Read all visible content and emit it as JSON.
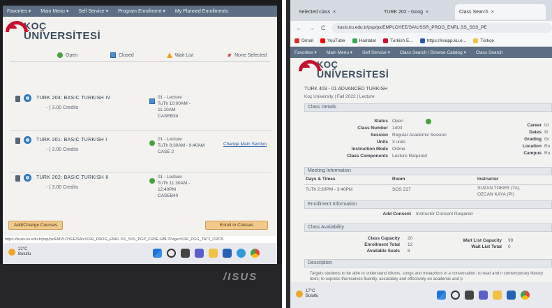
{
  "left": {
    "nav": [
      "Favorites ▾",
      "Main Menu ▾",
      "Self Service ▾",
      "Program Enrollment ▾",
      "My Planned Enrollments"
    ],
    "logo": {
      "line1": "KOÇ",
      "line2": "ÜNİVERSİTESİ"
    },
    "legend": {
      "open": "Open",
      "closed": "Closed",
      "wait": "Wait List",
      "none": "None Selected"
    },
    "courses": [
      {
        "name": "TURK 204: BASIC TURKISH IV",
        "credits": "- ( 3.00 Credits",
        "section": "01 - Lecture",
        "time": "TuTh 10:00AM -",
        "time2": "11:10AM",
        "room": "CASEB34",
        "status": "closed",
        "change": ""
      },
      {
        "name": "TURK 201: BASIC TURKISH I",
        "credits": "- ( 3.00 Credits",
        "section": "01 - Lecture",
        "time": "TuTh 8:30AM - 9:40AM",
        "time2": "",
        "room": "CASE 2",
        "status": "open",
        "change": "Change Main Section"
      },
      {
        "name": "TURK 202: BASIC TURKISH II",
        "credits": "- ( 3.00 Credits",
        "section": "01 - Lecture",
        "time": "TuTh 11:30AM -",
        "time2": "12:40PM",
        "room": "CASEB40",
        "status": "open",
        "change": ""
      }
    ],
    "add_change_button": "Add/Change Courses",
    "enroll_button": "Enroll in Classes",
    "status_url": "https://kusis.ku.edu.tr/psp/ps/EMPLOYEE/SA/c/SSR_PROG_ENRL.SS_SSS_PGP_CRSE.GBL?Page=SSR_PGG_TAT2_CROS",
    "weather": {
      "temp": "22°C",
      "desc": "Bulutlu"
    },
    "brand": "/ISUS"
  },
  "right": {
    "tabs": [
      "Selected class",
      "TURK 202 - Goog",
      "Class Search"
    ],
    "address": "kusis.ku.edu.tr/psp/ps/EMPLOYEE/SA/c/SSR_PROG_ENRL.SS_SSS_PE",
    "bookmarks": [
      "Gmail",
      "YouTube",
      "Haritalar",
      "Turkish E...",
      "https://ksapp.ku.e...",
      "Türkçe"
    ],
    "nav": [
      "Favorites ▾",
      "Main Menu ▾",
      "Self Service ▾",
      "Class Search / Browse Catalog ▾",
      "Class Search"
    ],
    "logo": {
      "line1": "KOÇ",
      "line2": "ÜNİVERSİTESİ"
    },
    "course_title": "TURK 403 - 01   ADVANCED TURKISH",
    "course_sub": "Koç University | Fall 2022 | Lecture",
    "class_details_header": "Class Details",
    "details": [
      {
        "label": "Status",
        "value": "Open"
      },
      {
        "label": "Class Number",
        "value": "1403"
      },
      {
        "label": "Session",
        "value": "Regular Academic Session"
      },
      {
        "label": "Units",
        "value": "3 units"
      },
      {
        "label": "Instruction Mode",
        "value": "Online"
      },
      {
        "label": "Class Components",
        "value": "Lecture Required"
      }
    ],
    "details_right": [
      {
        "label": "Career",
        "value": "Ur"
      },
      {
        "label": "Dates",
        "value": "9/"
      },
      {
        "label": "Grading",
        "value": "Gr"
      },
      {
        "label": "Location",
        "value": "Ru"
      },
      {
        "label": "Campus",
        "value": "Ru"
      }
    ],
    "meeting_header": "Meeting Information",
    "meeting_cols": {
      "days": "Days & Times",
      "room": "Room",
      "instructor": "Instructor"
    },
    "meeting": {
      "days": "TuTh 2:30PM - 3:40PM",
      "room": "SOS Z27",
      "instructor1": "SUZAN TOKER (TA),",
      "instructor2": "OZCAN KAYA (PI)"
    },
    "enrollment_header": "Enrollment Information",
    "add_consent_label": "Add Consent",
    "add_consent_value": "Instructor Consent Required",
    "availability_header": "Class Availability",
    "availability": [
      {
        "label": "Class Capacity",
        "value": "20"
      },
      {
        "label": "Enrollment Total",
        "value": "12"
      },
      {
        "label": "Available Seats",
        "value": "8"
      }
    ],
    "waitlist": [
      {
        "label": "Wait List Capacity",
        "value": "99"
      },
      {
        "label": "Wait List Total",
        "value": "0"
      }
    ],
    "description_header": "Description",
    "description": "Targets students to be able to understand idioms, songs and metaphors in a conversation; to read and n contemporary literary texts; to express themselves fluently, accurately and effectively on academic and p",
    "weather": {
      "temp": "17°C",
      "desc": "Bulutlu"
    }
  }
}
